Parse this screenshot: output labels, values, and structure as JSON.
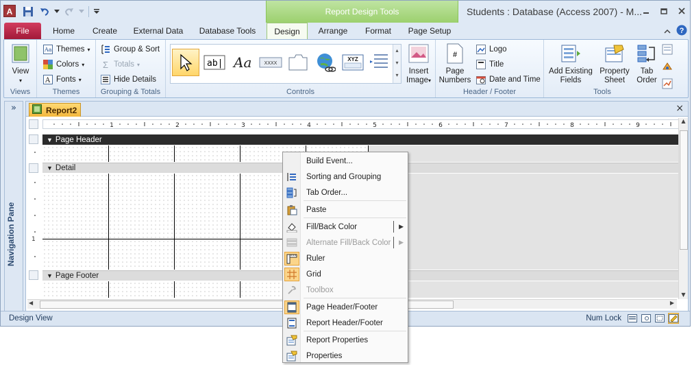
{
  "window": {
    "title": "Students : Database (Access 2007) - M...",
    "contextual_group": "Report Design Tools",
    "app_icon_letter": "A"
  },
  "tabs": {
    "file": "File",
    "items": [
      "Home",
      "Create",
      "External Data",
      "Database Tools",
      "Design",
      "Arrange",
      "Format",
      "Page Setup"
    ],
    "active": "Design"
  },
  "ribbon": {
    "views": {
      "view_label": "View",
      "group": "Views"
    },
    "themes": {
      "themes": "Themes",
      "colors": "Colors",
      "fonts": "Fonts",
      "group": "Themes"
    },
    "grouping": {
      "group_sort": "Group & Sort",
      "totals": "Totals",
      "hide_details": "Hide Details",
      "group": "Grouping & Totals"
    },
    "controls": {
      "group": "Controls",
      "insert_image_1": "Insert",
      "insert_image_2": "Image",
      "label_text": "ab|",
      "button_text": "XXXX",
      "xyz_text": "XYZ"
    },
    "header_footer": {
      "page_numbers_1": "Page",
      "page_numbers_2": "Numbers",
      "logo": "Logo",
      "title": "Title",
      "date_time": "Date and Time",
      "group": "Header / Footer"
    },
    "tools": {
      "add_fields_1": "Add Existing",
      "add_fields_2": "Fields",
      "prop_sheet_1": "Property",
      "prop_sheet_2": "Sheet",
      "tab_order_1": "Tab",
      "tab_order_2": "Order",
      "group": "Tools"
    }
  },
  "nav_pane": {
    "label": "Navigation Pane",
    "toggle": "»"
  },
  "document": {
    "tab_label": "Report2",
    "close": "×",
    "sections": {
      "page_header": "Page Header",
      "detail": "Detail",
      "page_footer": "Page Footer"
    },
    "ruler_numbers": [
      "1",
      "2",
      "3",
      "4",
      "5",
      "6",
      "7",
      "8",
      "9"
    ],
    "vruler_number": "1"
  },
  "context_menu": {
    "items": [
      {
        "label": "Build Event...",
        "icon": "none",
        "disabled": false,
        "submenu": false
      },
      {
        "label": "Sorting and Grouping",
        "icon": "sort-group-icon",
        "disabled": false,
        "submenu": false
      },
      {
        "label": "Tab Order...",
        "icon": "tab-order-icon",
        "disabled": false,
        "submenu": false
      },
      {
        "label": "Paste",
        "icon": "paste-icon",
        "disabled": false,
        "submenu": false
      },
      {
        "label": "Fill/Back Color",
        "icon": "fill-color-icon",
        "disabled": false,
        "submenu": true
      },
      {
        "label": "Alternate Fill/Back Color",
        "icon": "alternate-fill-icon",
        "disabled": true,
        "submenu": true
      },
      {
        "label": "Ruler",
        "icon": "ruler-icon",
        "disabled": false,
        "submenu": false,
        "checked": true
      },
      {
        "label": "Grid",
        "icon": "grid-icon",
        "disabled": false,
        "submenu": false,
        "checked": true
      },
      {
        "label": "Toolbox",
        "icon": "toolbox-icon",
        "disabled": true,
        "submenu": false
      },
      {
        "label": "Page Header/Footer",
        "icon": "page-header-footer-icon",
        "disabled": false,
        "submenu": false,
        "checked": true
      },
      {
        "label": "Report Header/Footer",
        "icon": "report-header-footer-icon",
        "disabled": false,
        "submenu": false
      },
      {
        "label": "Report Properties",
        "icon": "report-properties-icon",
        "disabled": false,
        "submenu": false
      },
      {
        "label": "Properties",
        "icon": "properties-icon",
        "disabled": false,
        "submenu": false
      }
    ]
  },
  "statusbar": {
    "left": "Design View",
    "right": "Num Lock"
  }
}
